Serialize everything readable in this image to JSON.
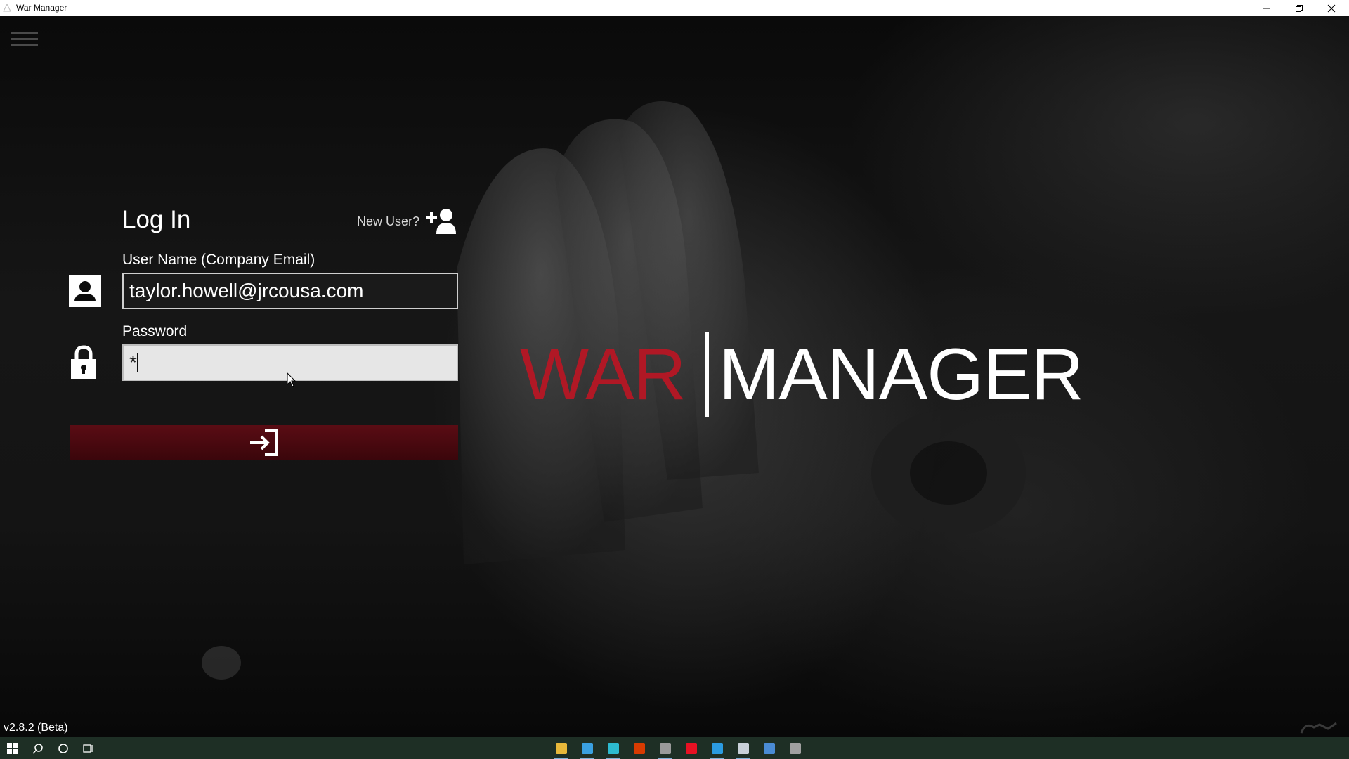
{
  "window": {
    "title": "War Manager",
    "controls": [
      "minimize",
      "restore",
      "close"
    ]
  },
  "login": {
    "heading": "Log In",
    "new_user_label": "New User?",
    "username_label": "User Name (Company Email)",
    "username_value": "taylor.howell@jrcousa.com",
    "password_label": "Password",
    "password_value": "*",
    "submit_icon": "sign-in-icon"
  },
  "logo": {
    "part1": "WAR",
    "part2": "MANAGER"
  },
  "version": "v2.8.2 (Beta)",
  "colors": {
    "accent_red": "#b01825",
    "button_red": "#4a0910",
    "taskbar": "#1e2f25"
  },
  "taskbar": {
    "system_buttons": [
      "windows-start-icon",
      "search-icon",
      "cortana-icon",
      "task-view-icon"
    ],
    "apps": [
      {
        "name": "file-explorer-icon",
        "color": "#e8b83a",
        "active": true
      },
      {
        "name": "notepad-icon",
        "color": "#3aa0e0",
        "active": true
      },
      {
        "name": "edge-icon",
        "color": "#2dbbd0",
        "active": true
      },
      {
        "name": "office-icon",
        "color": "#d83b01",
        "active": false
      },
      {
        "name": "war-manager-icon",
        "color": "#9a9a9a",
        "active": true
      },
      {
        "name": "record-icon",
        "color": "#e81123",
        "active": false
      },
      {
        "name": "vscode-icon",
        "color": "#2b9be0",
        "active": true
      },
      {
        "name": "notes-icon",
        "color": "#c8d0d8",
        "active": true
      },
      {
        "name": "photos-icon",
        "color": "#4a8bd4",
        "active": false
      },
      {
        "name": "clock-icon",
        "color": "#a0a0a0",
        "active": false
      }
    ]
  }
}
